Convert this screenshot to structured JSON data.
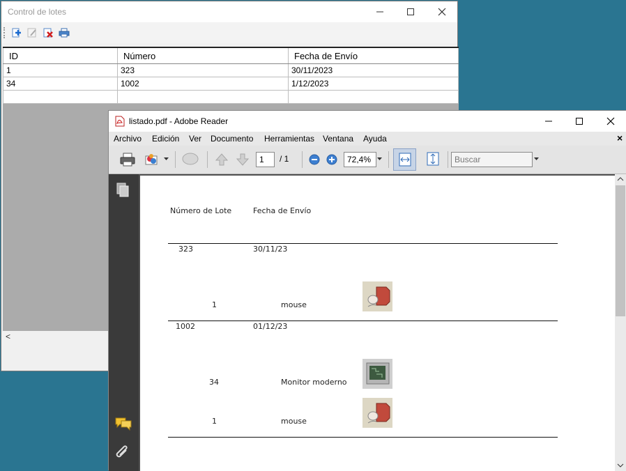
{
  "control_lotes": {
    "title": "Control de lotes",
    "toolbar": {
      "add_label": "Agregar",
      "edit_label": "Editar",
      "delete_label": "Eliminar",
      "print_label": "Imprimir"
    },
    "columns": [
      "ID",
      "Número",
      "Fecha de Envío"
    ],
    "rows": [
      [
        "1",
        "323",
        "30/11/2023"
      ],
      [
        "34",
        "1002",
        "1/12/2023"
      ],
      [
        "",
        "",
        ""
      ]
    ],
    "scroll_left": "<"
  },
  "reader": {
    "title": "listado.pdf - Adobe Reader",
    "menu": [
      "Archivo",
      "Edición",
      "Ver",
      "Documento",
      "Herramientas",
      "Ventana",
      "Ayuda"
    ],
    "page_current": "1",
    "page_total": "/ 1",
    "zoom": "72,4%",
    "search_placeholder": "Buscar",
    "close_doc": "×"
  },
  "pdf": {
    "header_lote": "Número de Lote",
    "header_fecha": "Fecha de Envío",
    "groups": [
      {
        "lote": "323",
        "fecha": "30/11/23",
        "items": [
          {
            "id": "1",
            "name": "mouse",
            "image": "mouse-icon"
          }
        ]
      },
      {
        "lote": "1002",
        "fecha": "01/12/23",
        "items": [
          {
            "id": "34",
            "name": "Monitor moderno",
            "image": "monitor-icon"
          },
          {
            "id": "1",
            "name": "mouse",
            "image": "mouse-icon"
          }
        ]
      }
    ]
  },
  "colors": {
    "desktop": "#2a7591",
    "reader_dark_panel": "#3a3a3a",
    "reader_doc_bg": "#505050"
  }
}
